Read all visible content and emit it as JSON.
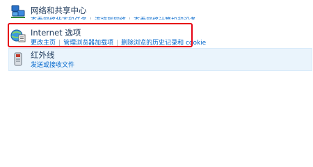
{
  "network_sharing": {
    "title": "网络和共享中心",
    "links": [
      "查看网络状态和任务",
      "连接到网络",
      "查看网络计算机和设备"
    ]
  },
  "internet_options": {
    "title": "Internet 选项",
    "links": [
      "更改主页",
      "管理浏览器加载项",
      "删除浏览的历史记录和 cookie"
    ]
  },
  "infrared": {
    "title": "红外线",
    "links": [
      "发送或接收文件"
    ]
  },
  "colors": {
    "highlight_border": "#e60012",
    "link": "#0066cc",
    "title": "#1e395b",
    "hover_bg": "#eaf4fc"
  },
  "icons": [
    "network-sharing-icon",
    "internet-options-icon",
    "infrared-icon"
  ]
}
